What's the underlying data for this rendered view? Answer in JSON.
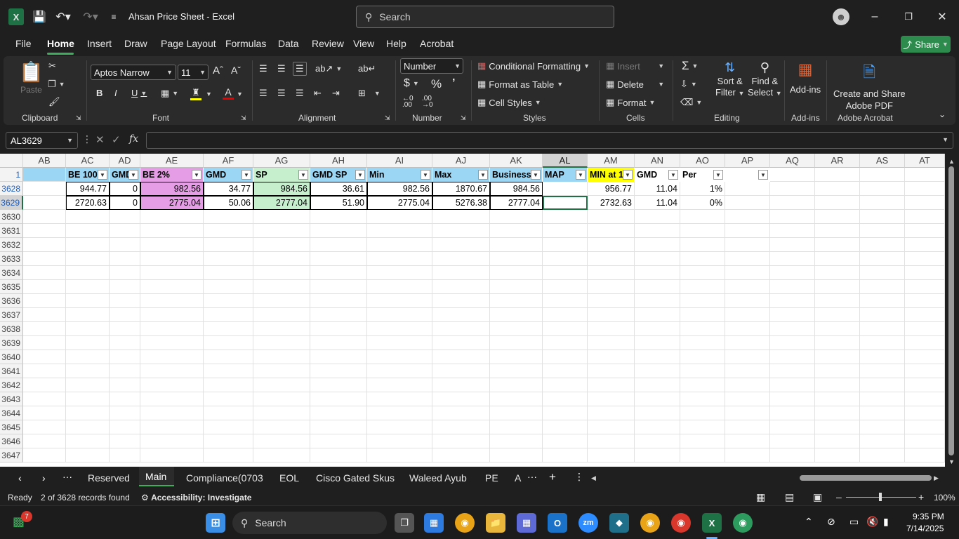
{
  "window": {
    "title": "Ahsan Price Sheet  -  Excel",
    "search_placeholder": "Search"
  },
  "menu": {
    "tabs": [
      "File",
      "Home",
      "Insert",
      "Draw",
      "Page Layout",
      "Formulas",
      "Data",
      "Review",
      "View",
      "Help",
      "Acrobat"
    ],
    "active": "Home",
    "share_label": "Share"
  },
  "ribbon": {
    "clipboard": {
      "paste": "Paste",
      "group": "Clipboard"
    },
    "font": {
      "name": "Aptos Narrow",
      "size": "11",
      "group": "Font"
    },
    "alignment": {
      "group": "Alignment"
    },
    "number": {
      "format": "Number",
      "group": "Number"
    },
    "styles": {
      "conditional": "Conditional Formatting",
      "format_table": "Format as Table",
      "cell_styles": "Cell Styles",
      "group": "Styles"
    },
    "cells": {
      "insert": "Insert",
      "delete": "Delete",
      "format": "Format",
      "group": "Cells"
    },
    "editing": {
      "sort_l1": "Sort &",
      "sort_l2": "Filter",
      "find_l1": "Find &",
      "find_l2": "Select",
      "group": "Editing"
    },
    "addins": {
      "label": "Add-ins",
      "group": "Add-ins"
    },
    "acrobat": {
      "l1": "Create and Share",
      "l2": "Adobe PDF",
      "group": "Adobe Acrobat"
    }
  },
  "formula_bar": {
    "name_box": "AL3629",
    "fx": "fx",
    "content": ""
  },
  "grid": {
    "columns": [
      "AB",
      "AC",
      "AD",
      "AE",
      "AF",
      "AG",
      "AH",
      "AI",
      "AJ",
      "AK",
      "AL",
      "AM",
      "AN",
      "AO",
      "AP",
      "AQ",
      "AR",
      "AS",
      "AT"
    ],
    "selected_column": "AL",
    "header_row": "1",
    "headers": [
      "",
      "BE 100",
      "GMD",
      "BE 2%",
      "GMD",
      "SP",
      "GMD SP",
      "Min",
      "Max",
      "Business",
      "MAP",
      "MIN at 1",
      "GMD",
      "Per",
      ""
    ],
    "data_rows": [
      {
        "row": "3628",
        "cells": [
          "",
          "944.77",
          "0",
          "982.56",
          "34.77",
          "984.56",
          "36.61",
          "982.56",
          "1870.67",
          "984.56",
          "",
          "956.77",
          "11.04",
          "1%",
          ""
        ]
      },
      {
        "row": "3629",
        "cells": [
          "",
          "2720.63",
          "0",
          "2775.04",
          "50.06",
          "2777.04",
          "51.90",
          "2775.04",
          "5276.38",
          "2777.04",
          "",
          "2732.63",
          "11.04",
          "0%",
          ""
        ]
      }
    ],
    "empty_rows": [
      "3630",
      "3631",
      "3632",
      "3633",
      "3634",
      "3635",
      "3636",
      "3637",
      "3638",
      "3639",
      "3640",
      "3641",
      "3642",
      "3643",
      "3644",
      "3645",
      "3646",
      "3647"
    ],
    "colors": {
      "header_blue": "#9bd7f5",
      "pink": "#e59ee5",
      "green": "#c6efce",
      "yellow": "#ffff00"
    }
  },
  "sheets": {
    "tabs": [
      "Reserved",
      "Main",
      "Compliance(0703",
      "EOL",
      "Cisco Gated Skus",
      "Waleed Ayub",
      "PE",
      "A"
    ],
    "active": "Main"
  },
  "status": {
    "ready": "Ready",
    "records": "2 of 3628 records found",
    "accessibility": "Accessibility: Investigate",
    "zoom": "100%"
  },
  "taskbar": {
    "search": "Search",
    "time": "9:35 PM",
    "date": "7/14/2025",
    "badge": "7"
  }
}
